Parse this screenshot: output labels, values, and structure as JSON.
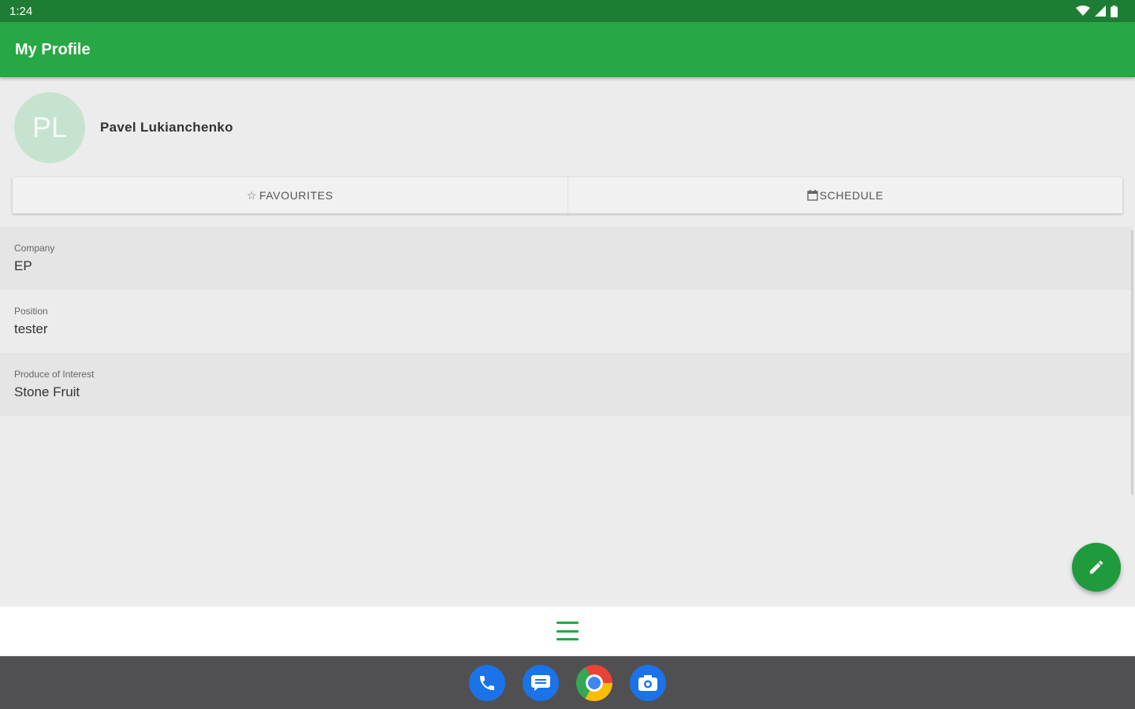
{
  "status_bar": {
    "time": "1:24"
  },
  "app_bar": {
    "title": "My Profile"
  },
  "profile": {
    "initials": "PL",
    "name": "Pavel Lukianchenko"
  },
  "tabs": [
    {
      "icon": "star-outline-icon",
      "label": "FAVOURITES"
    },
    {
      "icon": "calendar-icon",
      "label": "SCHEDULE"
    }
  ],
  "fields": [
    {
      "label": "Company",
      "value": "EP"
    },
    {
      "label": "Position",
      "value": "tester"
    },
    {
      "label": "Produce of Interest",
      "value": "Stone Fruit"
    }
  ],
  "fab": {
    "icon": "pencil-icon"
  },
  "bottom_nav": {
    "icon": "hamburger-menu-icon"
  },
  "dock": {
    "apps": [
      "phone-icon",
      "messages-icon",
      "chrome-icon",
      "camera-icon"
    ]
  },
  "colors": {
    "primary": "#28a745",
    "status_bar": "#1e7d34",
    "avatar_bg": "#c6e3d0",
    "dock_bg": "#505053"
  }
}
